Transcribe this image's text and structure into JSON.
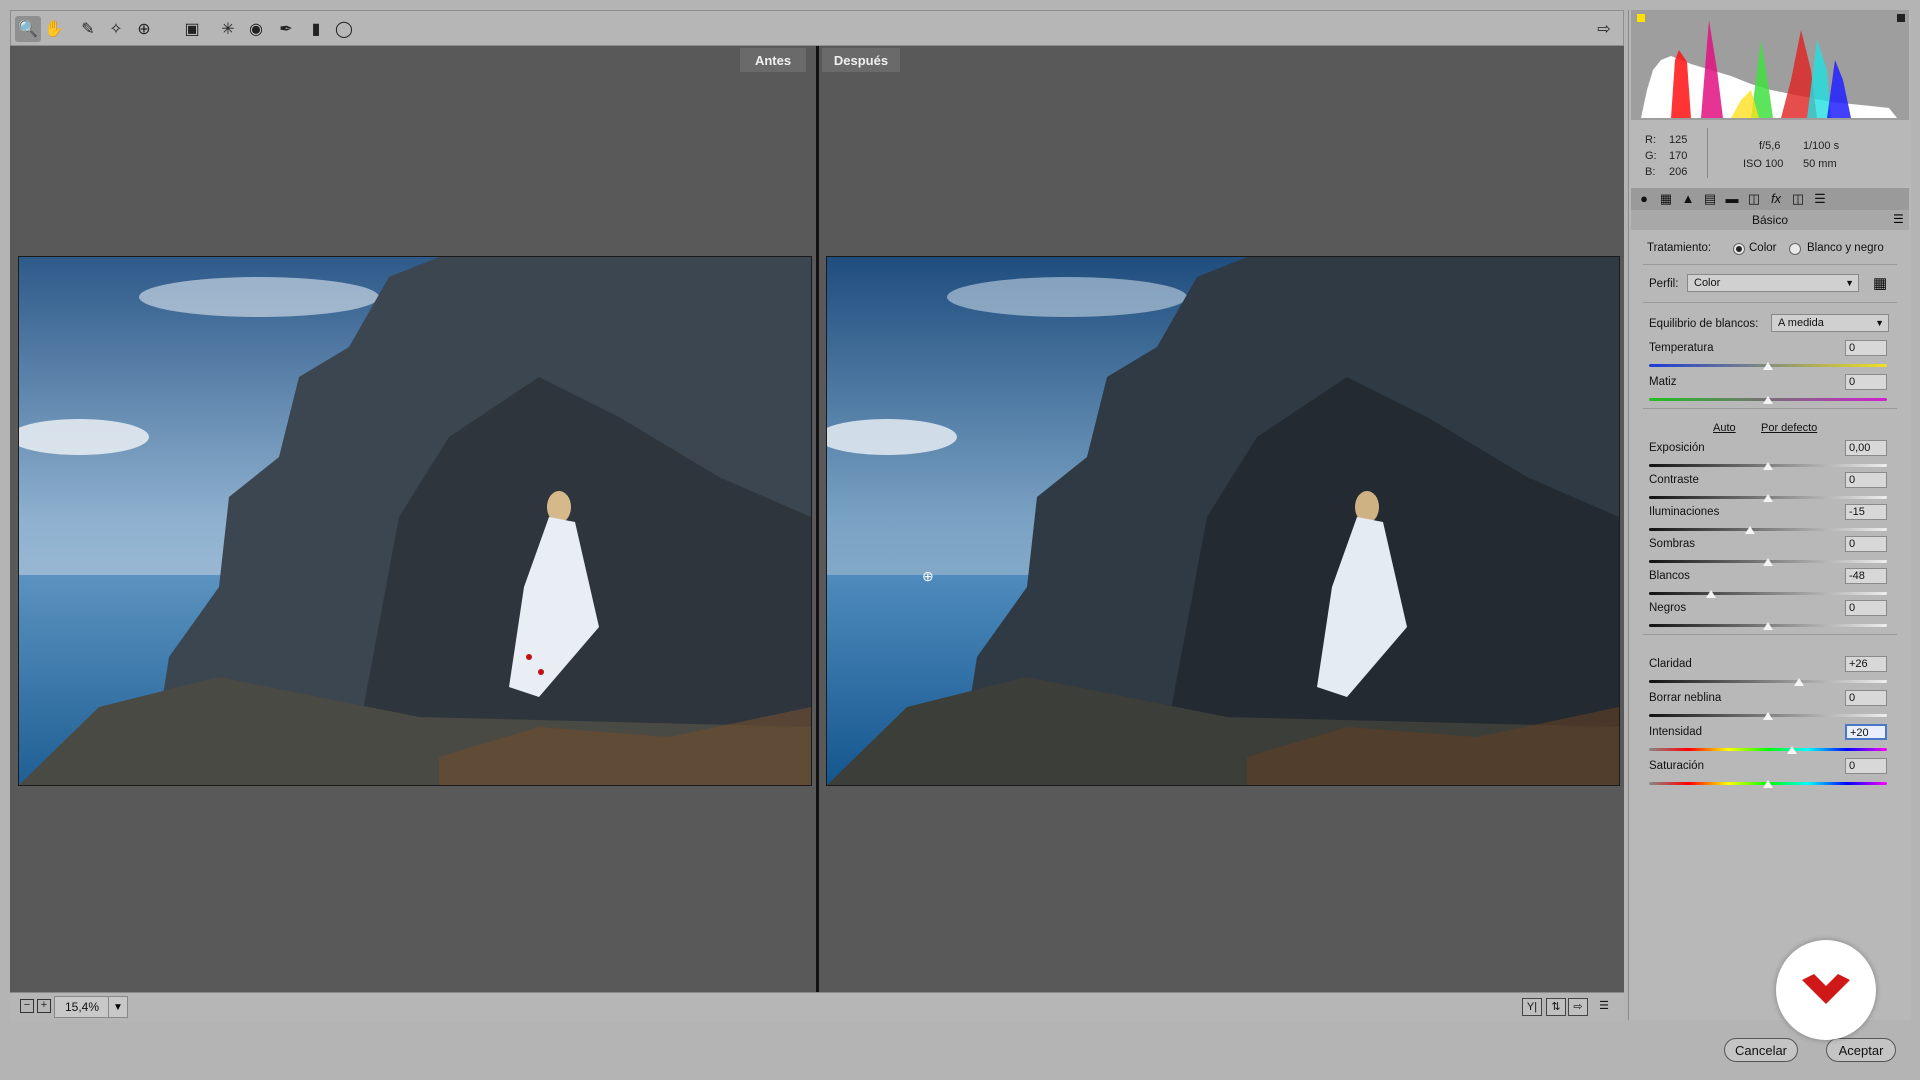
{
  "toolbar": {
    "tools": [
      "zoom-icon",
      "hand-icon",
      "eyedropper-icon",
      "color-sampler-icon",
      "target-adjust-icon",
      "crop-icon",
      "spot-removal-icon",
      "red-eye-icon",
      "brush-icon",
      "gradient-icon",
      "radial-filter-icon"
    ],
    "open_panel_icon": "panel-toggle-icon"
  },
  "compare": {
    "before_label": "Antes",
    "after_label": "Después"
  },
  "status": {
    "zoom": "15,4%"
  },
  "info": {
    "r_label": "R:",
    "r_value": "125",
    "g_label": "G:",
    "g_value": "170",
    "b_label": "B:",
    "b_value": "206",
    "aperture": "f/5,6",
    "shutter": "1/100 s",
    "iso": "ISO 100",
    "focal": "50 mm"
  },
  "panel": {
    "section_title": "Básico",
    "treatment_label": "Tratamiento:",
    "treatment_color": "Color",
    "treatment_bw": "Blanco y negro",
    "profile_label": "Perfil:",
    "profile_value": "Color",
    "wb_label": "Equilibrio de blancos:",
    "wb_value": "A medida",
    "auto_link": "Auto",
    "default_link": "Por defecto",
    "sliders": [
      {
        "label": "Temperatura",
        "value": "0",
        "level": 0.5
      },
      {
        "label": "Matiz",
        "value": "0",
        "level": 0.5
      },
      {
        "label": "Exposición",
        "value": "0,00",
        "level": 0.5
      },
      {
        "label": "Contraste",
        "value": "0",
        "level": 0.5
      },
      {
        "label": "Iluminaciones",
        "value": "-15",
        "level": 0.425
      },
      {
        "label": "Sombras",
        "value": "0",
        "level": 0.5
      },
      {
        "label": "Blancos",
        "value": "-48",
        "level": 0.26
      },
      {
        "label": "Negros",
        "value": "0",
        "level": 0.5
      },
      {
        "label": "Claridad",
        "value": "+26",
        "level": 0.63
      },
      {
        "label": "Borrar neblina",
        "value": "0",
        "level": 0.5
      },
      {
        "label": "Intensidad",
        "value": "+20",
        "level": 0.6
      },
      {
        "label": "Saturación",
        "value": "0",
        "level": 0.5
      }
    ]
  },
  "buttons": {
    "cancel": "Cancelar",
    "accept": "Aceptar"
  }
}
